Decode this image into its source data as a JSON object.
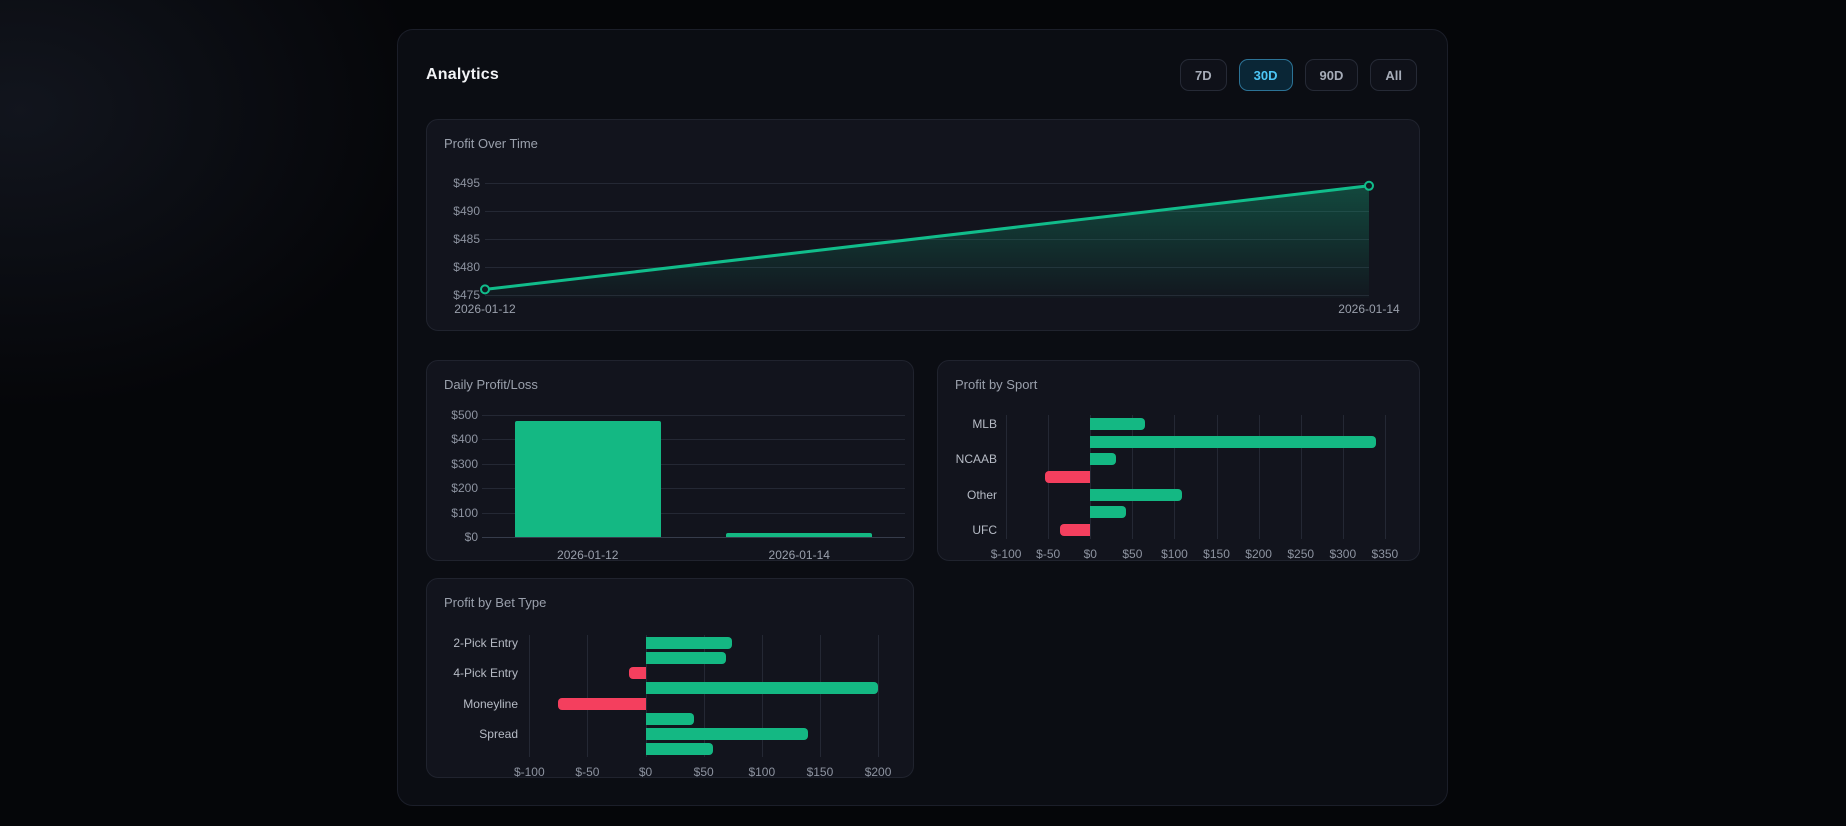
{
  "header": {
    "title": "Analytics",
    "ranges": [
      {
        "label": "7D",
        "active": false
      },
      {
        "label": "30D",
        "active": true
      },
      {
        "label": "90D",
        "active": false
      },
      {
        "label": "All",
        "active": false
      }
    ]
  },
  "colors": {
    "profit_green": "#14b883",
    "line_green": "#11bd8b",
    "loss_red": "#f43f5e",
    "active_range_text": "#4cc5f5"
  },
  "chart_data": [
    {
      "id": "profit-over-time",
      "type": "line",
      "title": "Profit Over Time",
      "x": [
        "2026-01-12",
        "2026-01-14"
      ],
      "values": [
        476,
        494.5
      ],
      "ylim": [
        475,
        495
      ],
      "yticks": [
        475,
        480,
        485,
        490,
        495
      ],
      "ytick_prefix": "$",
      "grid": "horizontal",
      "area": true,
      "legend": "none"
    },
    {
      "id": "daily-profit-loss",
      "type": "bar",
      "title": "Daily Profit/Loss",
      "categories": [
        "2026-01-12",
        "2026-01-14"
      ],
      "values": [
        475,
        18
      ],
      "ylim": [
        0,
        500
      ],
      "yticks": [
        0,
        100,
        200,
        300,
        400,
        500
      ],
      "ytick_prefix": "$",
      "grid": "horizontal",
      "legend": "none"
    },
    {
      "id": "profit-by-sport",
      "type": "hbar",
      "title": "Profit by Sport",
      "bars": [
        {
          "label": "MLB",
          "value": 65
        },
        {
          "label": "",
          "value": 340
        },
        {
          "label": "NCAAB",
          "value": 31
        },
        {
          "label": "",
          "value": -54
        },
        {
          "label": "Other",
          "value": 109
        },
        {
          "label": "",
          "value": 42
        },
        {
          "label": "UFC",
          "value": -36
        }
      ],
      "xlim": [
        -112,
        362
      ],
      "xticks": [
        -100,
        -50,
        0,
        50,
        100,
        150,
        200,
        250,
        300,
        350
      ],
      "xtick_prefix": "$",
      "grid": "vertical",
      "legend": "none"
    },
    {
      "id": "profit-by-bet-type",
      "type": "hbar",
      "title": "Profit by Bet Type",
      "bars": [
        {
          "label": "2-Pick Entry",
          "value": 74
        },
        {
          "label": "",
          "value": 69
        },
        {
          "label": "4-Pick Entry",
          "value": -14
        },
        {
          "label": "",
          "value": 200
        },
        {
          "label": "Moneyline",
          "value": -75
        },
        {
          "label": "",
          "value": 42
        },
        {
          "label": "Spread",
          "value": 140
        },
        {
          "label": "",
          "value": 58
        }
      ],
      "xlim": [
        -108,
        212
      ],
      "xticks": [
        -100,
        -50,
        0,
        50,
        100,
        150,
        200
      ],
      "xtick_prefix": "$",
      "grid": "vertical",
      "legend": "none"
    }
  ]
}
